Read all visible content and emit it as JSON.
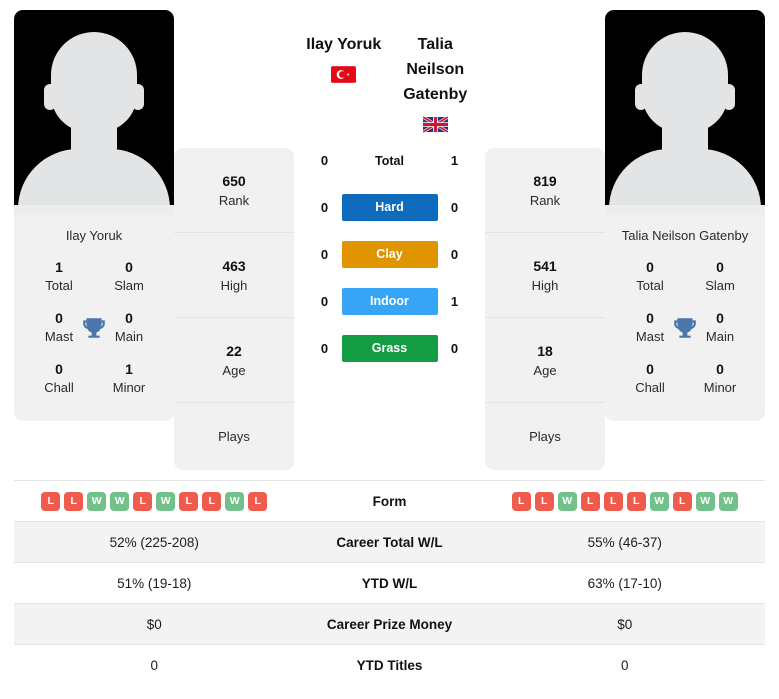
{
  "colors": {
    "hard": "#0f6cbd",
    "clay": "#df9400",
    "indoor": "#36a5f5",
    "grass": "#149c45",
    "win": "#72c18a",
    "loss": "#ef5b4c",
    "trophy": "#4a76ab"
  },
  "left_player": {
    "name": "Ilay Yoruk",
    "flag": "turkey-flag",
    "card_name": "Ilay Yoruk",
    "titles": [
      {
        "num": "1",
        "label": "Total"
      },
      {
        "num": "0",
        "label": "Slam"
      },
      {
        "num": "0",
        "label": "Mast"
      },
      {
        "num": "0",
        "label": "Main"
      },
      {
        "num": "0",
        "label": "Chall"
      },
      {
        "num": "1",
        "label": "Minor"
      }
    ],
    "info": [
      {
        "num": "650",
        "label": "Rank"
      },
      {
        "num": "463",
        "label": "High"
      },
      {
        "num": "22",
        "label": "Age"
      },
      {
        "num": "",
        "label": "Plays"
      }
    ],
    "form": [
      "L",
      "L",
      "W",
      "W",
      "L",
      "W",
      "L",
      "L",
      "W",
      "L"
    ]
  },
  "right_player": {
    "name": "Talia Neilson Gatenby",
    "flag": "united-kingdom-flag",
    "card_name": "Talia Neilson Gatenby",
    "titles": [
      {
        "num": "0",
        "label": "Total"
      },
      {
        "num": "0",
        "label": "Slam"
      },
      {
        "num": "0",
        "label": "Mast"
      },
      {
        "num": "0",
        "label": "Main"
      },
      {
        "num": "0",
        "label": "Chall"
      },
      {
        "num": "0",
        "label": "Minor"
      }
    ],
    "info": [
      {
        "num": "819",
        "label": "Rank"
      },
      {
        "num": "541",
        "label": "High"
      },
      {
        "num": "18",
        "label": "Age"
      },
      {
        "num": "",
        "label": "Plays"
      }
    ],
    "form": [
      "L",
      "L",
      "W",
      "L",
      "L",
      "L",
      "W",
      "L",
      "W",
      "W"
    ]
  },
  "h2h": [
    {
      "label": "Total",
      "left": "0",
      "right": "1",
      "style": "plain"
    },
    {
      "label": "Hard",
      "left": "0",
      "right": "0",
      "style": "hard"
    },
    {
      "label": "Clay",
      "left": "0",
      "right": "0",
      "style": "clay"
    },
    {
      "label": "Indoor",
      "left": "0",
      "right": "1",
      "style": "indoor"
    },
    {
      "label": "Grass",
      "left": "0",
      "right": "0",
      "style": "grass"
    }
  ],
  "stats_table": {
    "form_label": "Form",
    "rows": [
      {
        "label": "Career Total W/L",
        "left": "52% (225-208)",
        "right": "55% (46-37)"
      },
      {
        "label": "YTD W/L",
        "left": "51% (19-18)",
        "right": "63% (17-10)"
      },
      {
        "label": "Career Prize Money",
        "left": "$0",
        "right": "$0"
      },
      {
        "label": "YTD Titles",
        "left": "0",
        "right": "0"
      }
    ]
  }
}
